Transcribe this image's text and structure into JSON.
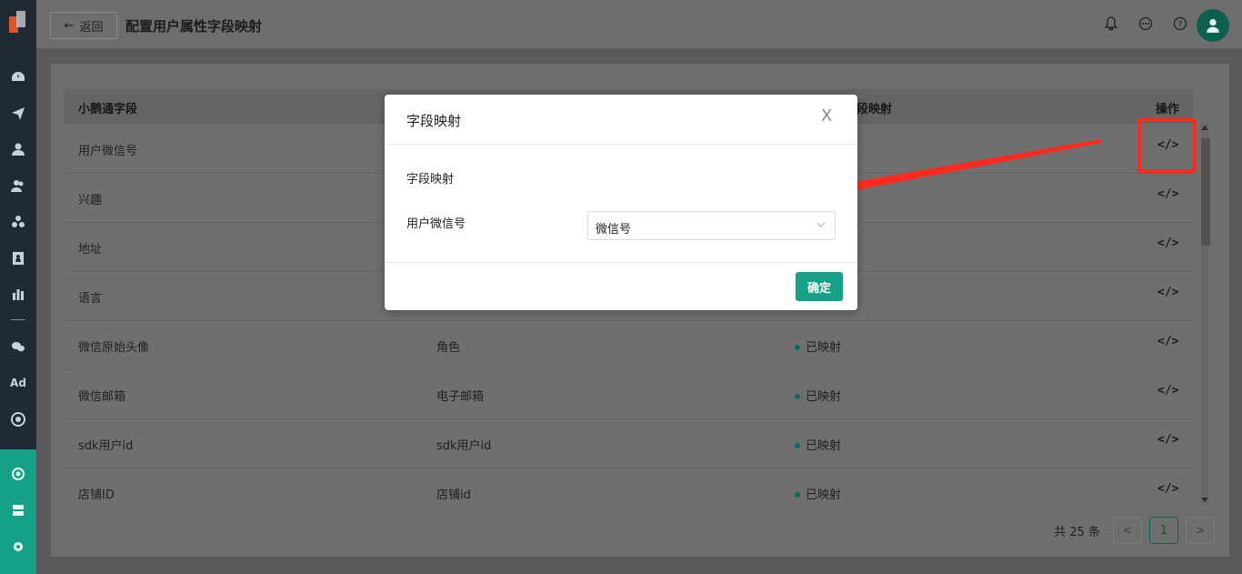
{
  "header": {
    "back_label": "返回",
    "title": "配置用户属性字段映射"
  },
  "table": {
    "headers": [
      "小鹅通字段",
      "",
      "段映射",
      "操作"
    ],
    "rows": [
      {
        "field": "用户微信号",
        "mapped": "",
        "status": ""
      },
      {
        "field": "兴趣",
        "mapped": "",
        "status": ""
      },
      {
        "field": "地址",
        "mapped": "",
        "status": ""
      },
      {
        "field": "语言",
        "mapped": "",
        "status": ""
      },
      {
        "field": "微信原始头像",
        "mapped": "角色",
        "status": "已映射"
      },
      {
        "field": "微信邮箱",
        "mapped": "电子邮箱",
        "status": "已映射"
      },
      {
        "field": "sdk用户id",
        "mapped": "sdk用户id",
        "status": "已映射"
      },
      {
        "field": "店铺ID",
        "mapped": "店铺id",
        "status": "已映射"
      }
    ],
    "op_icon": "</>"
  },
  "pagination": {
    "total_text": "共 25 条",
    "current_page": "1",
    "prev": "<",
    "next": ">"
  },
  "modal": {
    "title": "字段映射",
    "close": "X",
    "section_title": "字段映射",
    "field_label": "用户微信号",
    "select_value": "微信号",
    "ok_label": "确定"
  },
  "colors": {
    "accent": "#16a085",
    "annotation_red": "#ff2a1f"
  },
  "icons": [
    "dashboard-icon",
    "send-icon",
    "user-icon",
    "users-icon",
    "cluster-icon",
    "contact-card-icon",
    "bar-chart-icon",
    "wechat-icon",
    "ad-icon",
    "target-icon",
    "group-icon",
    "server-icon",
    "gear-icon",
    "bell-icon",
    "message-icon",
    "help-icon",
    "avatar-icon"
  ]
}
